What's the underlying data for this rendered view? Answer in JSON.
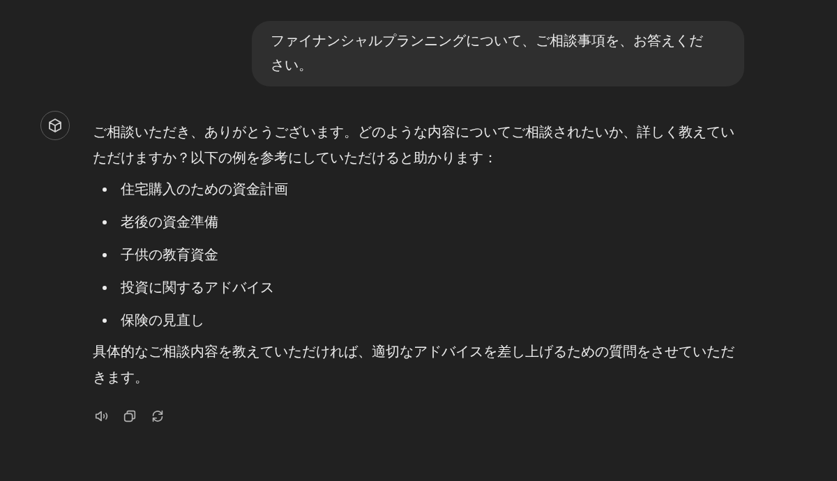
{
  "user_message": {
    "text": "ファイナンシャルプランニングについて、ご相談事項を、お答えください。"
  },
  "assistant_message": {
    "intro": "ご相談いただき、ありがとうございます。どのような内容についてご相談されたいか、詳しく教えていただけますか？以下の例を参考にしていただけると助かります：",
    "items": [
      "住宅購入のための資金計画",
      "老後の資金準備",
      "子供の教育資金",
      "投資に関するアドバイス",
      "保険の見直し"
    ],
    "closing": "具体的なご相談内容を教えていただければ、適切なアドバイスを差し上げるための質問をさせていただきます。"
  }
}
